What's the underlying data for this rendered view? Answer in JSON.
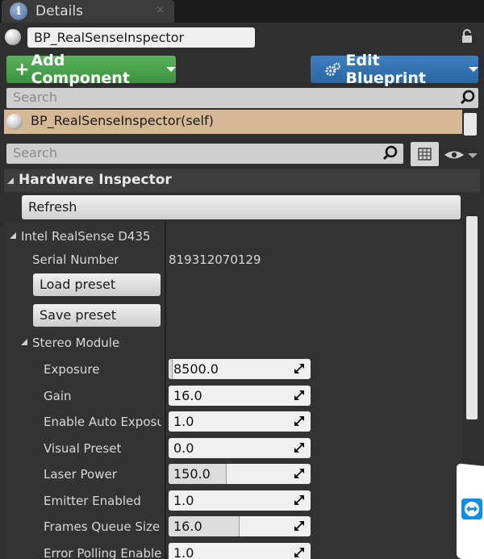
{
  "tab": {
    "title": "Details",
    "close_label": "×"
  },
  "actor": {
    "name": "BP_RealSenseInspector"
  },
  "toolbar": {
    "add_component_label": "Add Component",
    "edit_blueprint_label": "Edit Blueprint"
  },
  "component_search": {
    "placeholder": "Search"
  },
  "components": [
    {
      "label": "BP_RealSenseInspector(self)"
    }
  ],
  "details_search": {
    "placeholder": "Search"
  },
  "category": {
    "title": "Hardware Inspector",
    "refresh_label": "Refresh",
    "device": {
      "title": "Intel RealSense D435",
      "serial_label": "Serial Number",
      "serial_value": "819312070129",
      "load_preset_label": "Load preset",
      "save_preset_label": "Save preset",
      "module": {
        "title": "Stereo Module",
        "properties": [
          {
            "label": "Exposure",
            "value": "8500.0",
            "fill_fraction": 0.03
          },
          {
            "label": "Gain",
            "value": "16.0",
            "fill_fraction": 0.0
          },
          {
            "label": "Enable Auto Exposur",
            "value": "1.0",
            "fill_fraction": 0.0
          },
          {
            "label": "Visual Preset",
            "value": "0.0",
            "fill_fraction": 0.0
          },
          {
            "label": "Laser Power",
            "value": "150.0",
            "fill_fraction": 0.41
          },
          {
            "label": "Emitter Enabled",
            "value": "1.0",
            "fill_fraction": 0.0
          },
          {
            "label": "Frames Queue Size",
            "value": "16.0",
            "fill_fraction": 0.5
          },
          {
            "label": "Error Polling Enabled",
            "value": "1.0",
            "fill_fraction": 0.0
          }
        ]
      }
    }
  },
  "colors": {
    "add_button": "#4aa34d",
    "edit_button": "#3373b3",
    "selected_component": "#d6b895"
  }
}
